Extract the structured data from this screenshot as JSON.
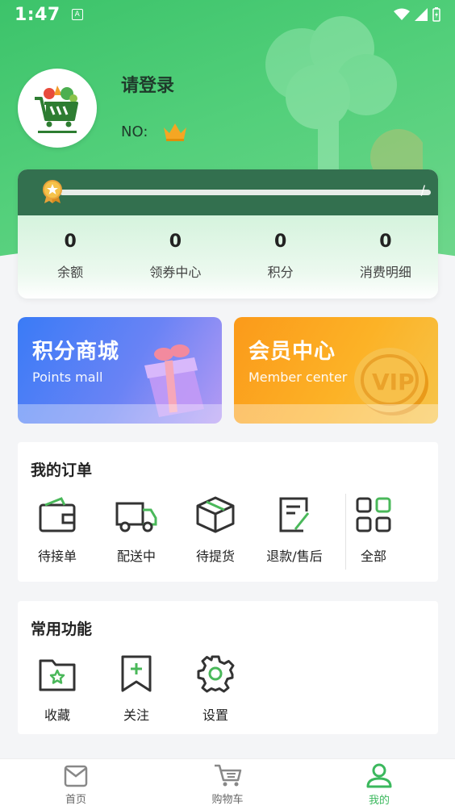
{
  "status_bar": {
    "time": "1:47",
    "a_badge": "A"
  },
  "profile": {
    "login_text": "请登录",
    "no_label": "NO:"
  },
  "progress": {
    "slash": "/"
  },
  "stats": [
    {
      "value": "0",
      "label": "余额"
    },
    {
      "value": "0",
      "label": "领券中心"
    },
    {
      "value": "0",
      "label": "积分"
    },
    {
      "value": "0",
      "label": "消费明细"
    }
  ],
  "banners": {
    "points": {
      "title": "积分商城",
      "subtitle": "Points mall"
    },
    "member": {
      "title": "会员中心",
      "subtitle": "Member center"
    }
  },
  "orders": {
    "title": "我的订单",
    "items": [
      {
        "label": "待接单",
        "icon": "wallet-icon"
      },
      {
        "label": "配送中",
        "icon": "truck-icon"
      },
      {
        "label": "待提货",
        "icon": "package-icon"
      },
      {
        "label": "退款/售后",
        "icon": "refund-icon"
      },
      {
        "label": "全部",
        "icon": "grid-icon"
      }
    ]
  },
  "tools": {
    "title": "常用功能",
    "items": [
      {
        "label": "收藏",
        "icon": "favorite-folder-icon"
      },
      {
        "label": "关注",
        "icon": "bookmark-add-icon"
      },
      {
        "label": "设置",
        "icon": "gear-icon"
      }
    ]
  },
  "bottom_nav": [
    {
      "label": "首页",
      "icon": "home-bag-icon",
      "active": false
    },
    {
      "label": "购物车",
      "icon": "cart-icon",
      "active": false
    },
    {
      "label": "我的",
      "icon": "user-icon",
      "active": true
    }
  ],
  "colors": {
    "accent_green": "#3bb85d",
    "header_green": "#4ccb75",
    "card_dark_green": "#33704f"
  }
}
